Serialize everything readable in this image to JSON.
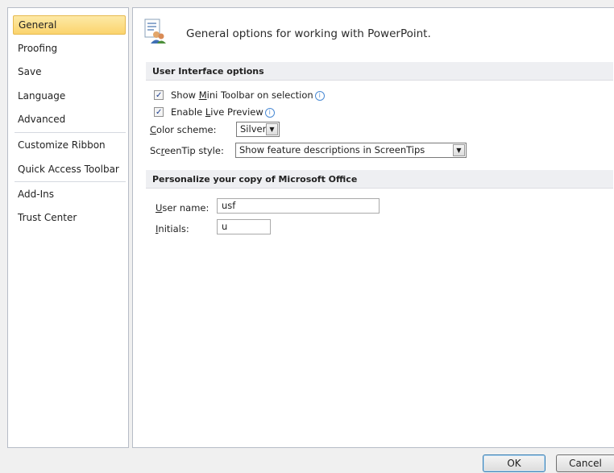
{
  "nav": {
    "items": [
      {
        "label": "General"
      },
      {
        "label": "Proofing"
      },
      {
        "label": "Save"
      },
      {
        "label": "Language"
      },
      {
        "label": "Advanced"
      },
      {
        "label": "Customize Ribbon"
      },
      {
        "label": "Quick Access Toolbar"
      },
      {
        "label": "Add-Ins"
      },
      {
        "label": "Trust Center"
      }
    ],
    "selected": "General"
  },
  "header": {
    "title": "General options for working with PowerPoint."
  },
  "ui_options": {
    "section_title": "User Interface options",
    "mini_toolbar": {
      "label_pre": "Show ",
      "label_key": "M",
      "label_post": "ini Toolbar on selection",
      "checked": true
    },
    "live_preview": {
      "label_pre": "Enable ",
      "label_key": "L",
      "label_post": "ive Preview",
      "checked": true
    },
    "color_scheme": {
      "label_key": "C",
      "label_post": "olor scheme:",
      "value": "Silver"
    },
    "screentip": {
      "label_pre": "Sc",
      "label_key": "r",
      "label_post": "eenTip style:",
      "value": "Show feature descriptions in ScreenTips"
    }
  },
  "personalize": {
    "section_title": "Personalize your copy of Microsoft Office",
    "username": {
      "label_key": "U",
      "label_post": "ser name:",
      "value": "usf"
    },
    "initials": {
      "label_key": "I",
      "label_post": "nitials:",
      "value": "u"
    }
  },
  "buttons": {
    "ok": "OK",
    "cancel": "Cancel"
  },
  "colors": {
    "selected_nav": "#fbd46d",
    "section_bar": "#eeeff2",
    "info_icon": "#4a8ad4"
  }
}
